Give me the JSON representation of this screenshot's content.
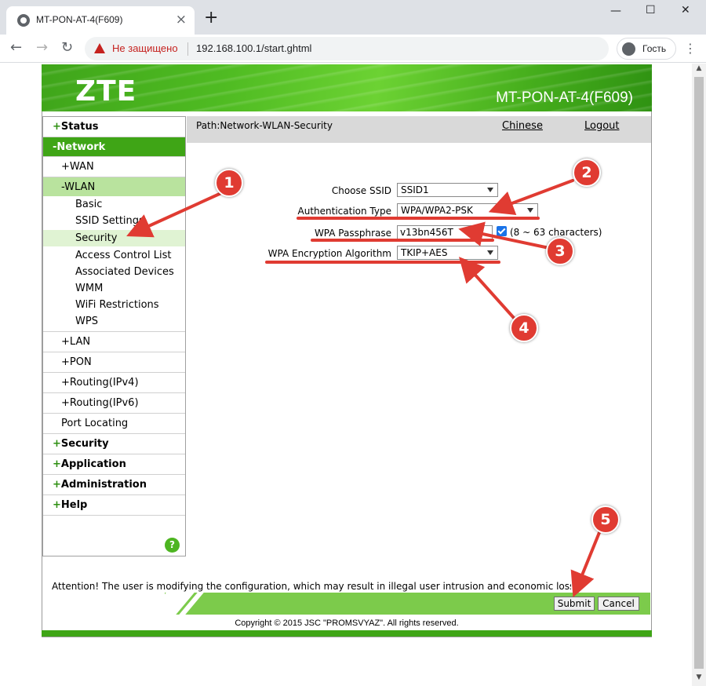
{
  "browser": {
    "tab_title": "MT-PON-AT-4(F609)",
    "new_tab": "+",
    "close_tab": "×",
    "window_minimize": "—",
    "window_maximize": "☐",
    "window_close": "✕",
    "nav_back": "←",
    "nav_forward": "→",
    "nav_reload": "↻",
    "security_warning": "Не защищено",
    "url": "192.168.100.1/start.ghtml",
    "profile_name": "Гость",
    "menu": "⋮"
  },
  "header": {
    "logo": "ZTE",
    "model": "MT-PON-AT-4(F609)"
  },
  "sidebar": {
    "status": "Status",
    "network": "-Network",
    "wan": "WAN",
    "wlan": "-WLAN",
    "wlan_items": [
      "Basic",
      "SSID Settings",
      "Security",
      "Access Control List",
      "Associated Devices",
      "WMM",
      "WiFi Restrictions",
      "WPS"
    ],
    "lan": "LAN",
    "pon": "PON",
    "routing_ipv4": "Routing(IPv4)",
    "routing_ipv6": "Routing(IPv6)",
    "port_locating": "Port Locating",
    "security": "Security",
    "application": "Application",
    "administration": "Administration",
    "help": "Help",
    "plus": "+",
    "help_icon": "?"
  },
  "topbar": {
    "path": "Path:Network-WLAN-Security",
    "chinese": "Chinese",
    "logout": "Logout"
  },
  "form": {
    "choose_ssid_label": "Choose SSID",
    "choose_ssid_value": "SSID1",
    "auth_type_label": "Authentication Type",
    "auth_type_value": "WPA/WPA2-PSK",
    "passphrase_label": "WPA Passphrase",
    "passphrase_value": "v13bn456T",
    "passphrase_hint": "(8 ~ 63 characters)",
    "encryption_label": "WPA Encryption Algorithm",
    "encryption_value": "TKIP+AES"
  },
  "footer": {
    "attention": "Attention! The user is modifying the configuration, which may result in illegal user intrusion and economic loss.",
    "submit": "Submit",
    "cancel": "Cancel",
    "copyright": "Copyright © 2015 JSC \"PROMSVYAZ\". All rights reserved."
  },
  "annotations": {
    "badge_1": "1",
    "badge_2": "2",
    "badge_3": "3",
    "badge_4": "4",
    "badge_5": "5",
    "color": "#e03b32"
  },
  "colors": {
    "brand_green": "#3fa516",
    "wlan_highlight": "#b9e39e",
    "warning_red": "#c5221f"
  }
}
